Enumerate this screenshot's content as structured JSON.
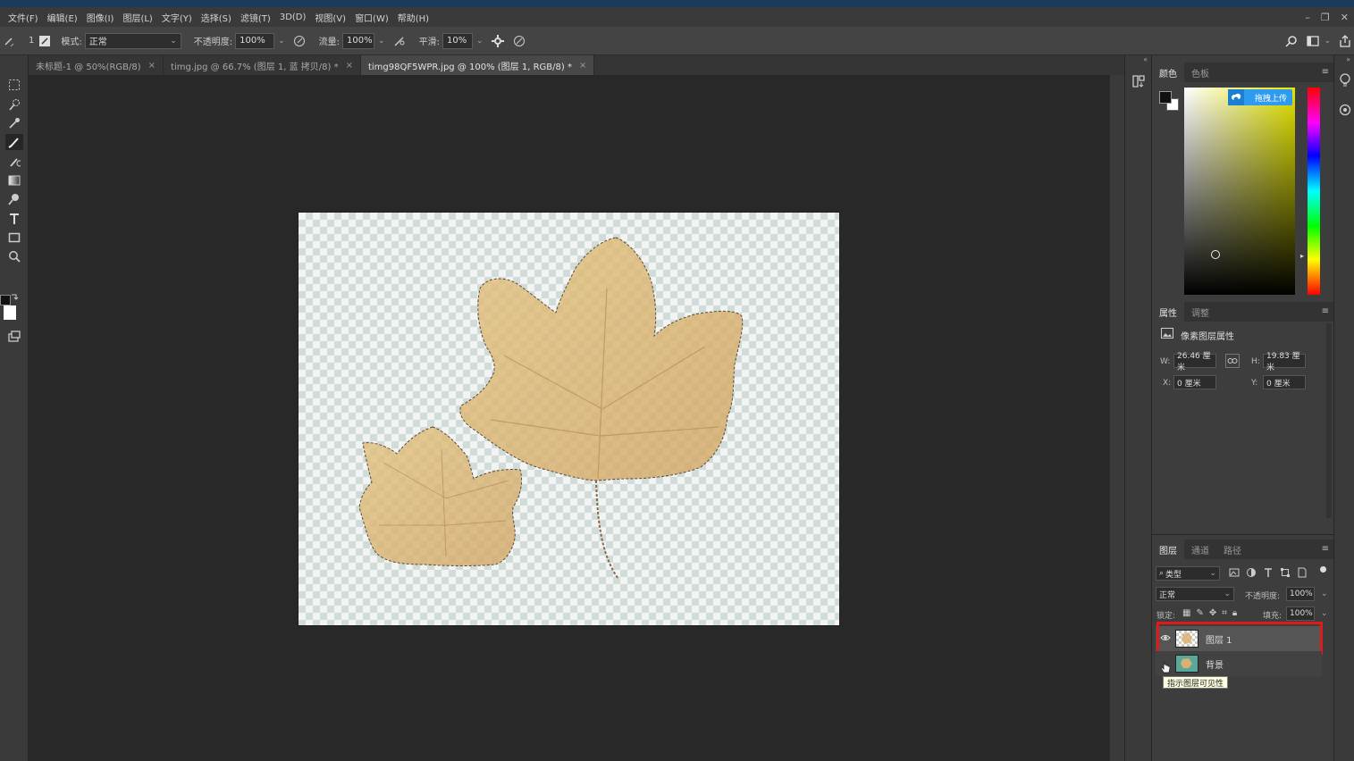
{
  "menubar": {
    "items": [
      "文件(F)",
      "编辑(E)",
      "图像(I)",
      "图层(L)",
      "文字(Y)",
      "选择(S)",
      "滤镜(T)",
      "3D(D)",
      "视图(V)",
      "窗口(W)",
      "帮助(H)"
    ]
  },
  "options": {
    "brush_size": "1",
    "mode_label": "模式:",
    "mode_value": "正常",
    "opacity_label": "不透明度:",
    "opacity_value": "100%",
    "flow_label": "流量:",
    "flow_value": "100%",
    "smooth_label": "平滑:",
    "smooth_value": "10%"
  },
  "tabs": [
    {
      "label": "未标题-1 @ 50%(RGB/8)",
      "close": "×"
    },
    {
      "label": "timg.jpg @ 66.7% (图层 1, 蓝 拷贝/8) *",
      "close": "×"
    },
    {
      "label": "timg98QF5WPR.jpg @ 100% (图层 1, RGB/8) *",
      "close": "×"
    }
  ],
  "color_panel": {
    "tabs": [
      "颜色",
      "色板"
    ],
    "upload_button": "拖拽上传",
    "accent": "#2f9bf0"
  },
  "properties_panel": {
    "tabs": [
      "属性",
      "调整"
    ],
    "title": "像素图层属性",
    "w_label": "W:",
    "w_value": "26.46 厘米",
    "h_label": "H:",
    "h_value": "19.83 厘米",
    "x_label": "X:",
    "x_value": "0 厘米",
    "y_label": "Y:",
    "y_value": "0 厘米"
  },
  "layers_panel": {
    "tabs": [
      "图层",
      "通道",
      "路径"
    ],
    "filter_label": "类型",
    "blend_mode": "正常",
    "opacity_label": "不透明度:",
    "opacity_value": "100%",
    "lock_label": "锁定:",
    "fill_label": "填充:",
    "fill_value": "100%",
    "layers": [
      {
        "name": "图层 1",
        "visible": true,
        "selected": true
      },
      {
        "name": "背景",
        "visible": false,
        "selected": false
      }
    ],
    "tooltip": "指示图层可见性",
    "highlight_color": "#e0191b"
  }
}
